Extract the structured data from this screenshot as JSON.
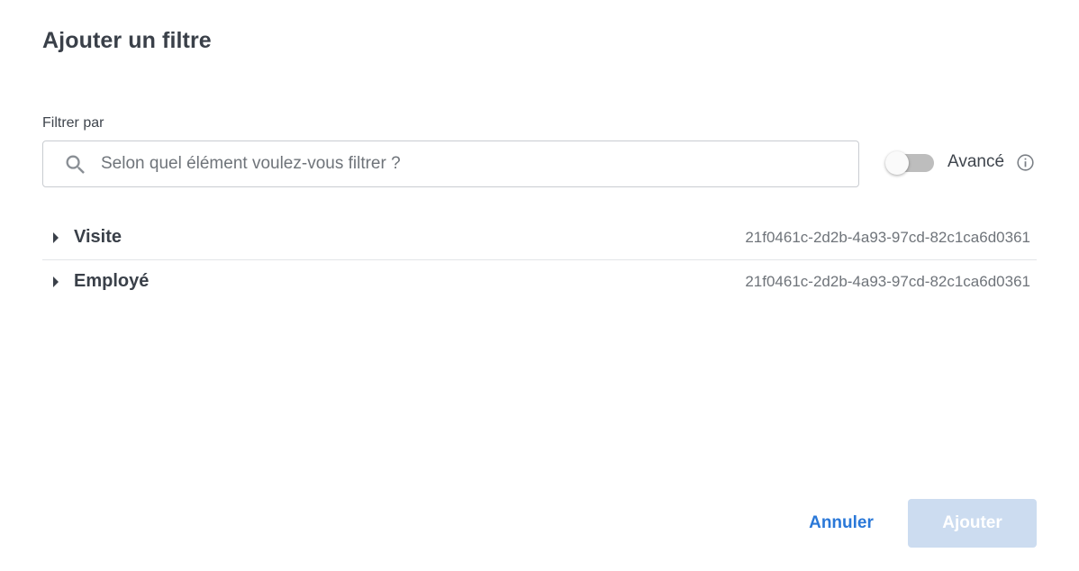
{
  "dialog": {
    "title": "Ajouter un filtre"
  },
  "filter": {
    "label": "Filtrer par",
    "placeholder": "Selon quel élément voulez-vous filtrer ?",
    "value": "",
    "search_icon": "search-icon"
  },
  "advanced": {
    "label": "Avancé",
    "enabled": false,
    "info_icon": "info-icon"
  },
  "tree": {
    "items": [
      {
        "label": "Visite",
        "id": "21f0461c-2d2b-4a93-97cd-82c1ca6d0361",
        "expanded": false
      },
      {
        "label": "Employé",
        "id": "21f0461c-2d2b-4a93-97cd-82c1ca6d0361",
        "expanded": false
      }
    ]
  },
  "actions": {
    "cancel_label": "Annuler",
    "add_label": "Ajouter",
    "add_disabled": true
  },
  "colors": {
    "accent": "#2a78d8",
    "disabled_button": "#ccdcf0",
    "toggle_track": "#bdbdbd"
  }
}
